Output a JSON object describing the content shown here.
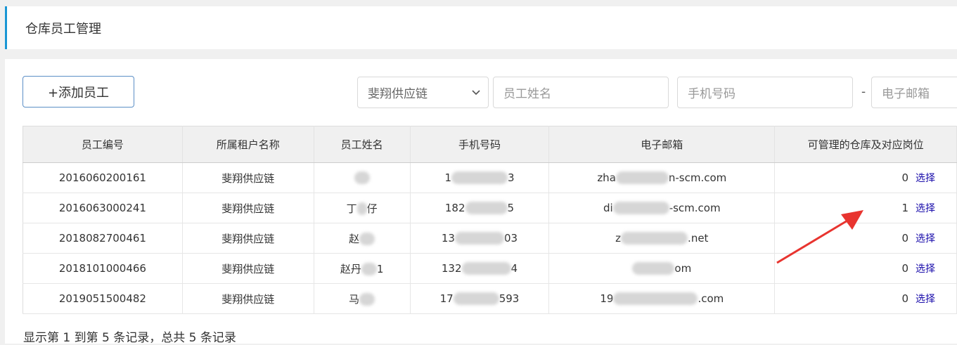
{
  "page": {
    "title": "仓库员工管理"
  },
  "toolbar": {
    "add_button": "+添加员工",
    "tenant_select": "斐翔供应链",
    "name_placeholder": "员工姓名",
    "phone_placeholder": "手机号码",
    "dash": "-",
    "email_placeholder": "电子邮箱"
  },
  "table": {
    "headers": [
      "员工编号",
      "所属租户名称",
      "员工姓名",
      "手机号码",
      "电子邮箱",
      "可管理的仓库及对应岗位"
    ],
    "rows": [
      {
        "id": "2016060200161",
        "tenant": "斐翔供应链",
        "name_a": "",
        "name_b": "",
        "phone_a": "1",
        "phone_b": "3",
        "email_a": "zha",
        "email_b": "n-scm.com",
        "count": "0",
        "action": "选择"
      },
      {
        "id": "2016063000241",
        "tenant": "斐翔供应链",
        "name_a": "丁",
        "name_b": "仔",
        "phone_a": "182",
        "phone_b": "5",
        "email_a": "di",
        "email_b": "-scm.com",
        "count": "1",
        "action": "选择"
      },
      {
        "id": "2018082700461",
        "tenant": "斐翔供应链",
        "name_a": "赵",
        "name_b": "",
        "phone_a": "13",
        "phone_b": "03",
        "email_a": "z",
        "email_b": ".net",
        "count": "0",
        "action": "选择"
      },
      {
        "id": "2018101000466",
        "tenant": "斐翔供应链",
        "name_a": "赵丹",
        "name_b": "1",
        "phone_a": "132",
        "phone_b": "4",
        "email_a": "",
        "email_b": "om",
        "count": "0",
        "action": "选择"
      },
      {
        "id": "2019051500482",
        "tenant": "斐翔供应链",
        "name_a": "马",
        "name_b": "",
        "phone_a": "17",
        "phone_b": "593",
        "email_a": "19",
        "email_b": ".com",
        "count": "0",
        "action": "选择"
      }
    ]
  },
  "footer": {
    "summary": "显示第 1 到第 5 条记录，总共 5 条记录"
  },
  "colors": {
    "accent": "#1a96d4",
    "link": "#1a0dab",
    "arrow": "#e8342f"
  }
}
